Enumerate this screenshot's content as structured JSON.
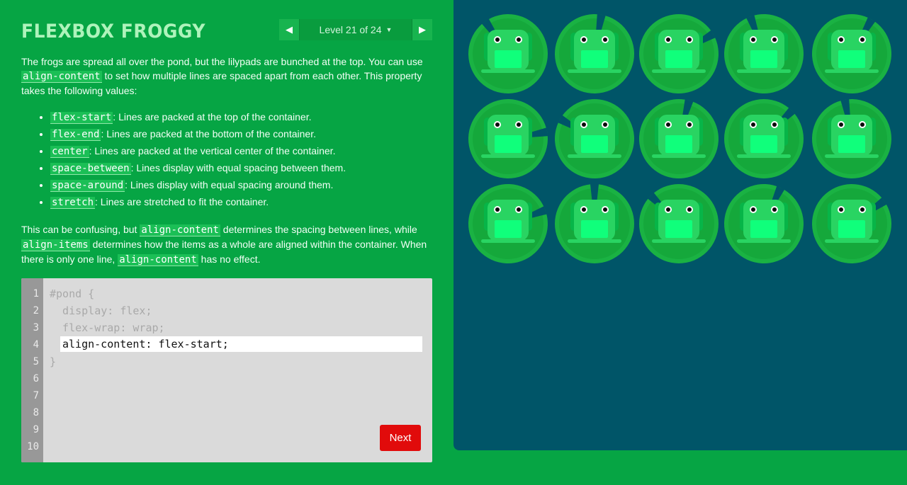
{
  "app": {
    "title": "FLEXBOX FROGGY"
  },
  "level_nav": {
    "label": "Level 21 of 24",
    "prev_icon": "arrow-left-icon",
    "next_icon": "arrow-right-icon",
    "dropdown_icon": "chevron-down-icon"
  },
  "instructions": {
    "intro_1": "The frogs are spread all over the pond, but the lilypads are bunched at the top. You can use ",
    "intro_code": "align-content",
    "intro_2": " to set how multiple lines are spaced apart from each other. This property takes the following values:",
    "values": [
      {
        "code": "flex-start",
        "text": ": Lines are packed at the top of the container."
      },
      {
        "code": "flex-end",
        "text": ": Lines are packed at the bottom of the container."
      },
      {
        "code": "center",
        "text": ": Lines are packed at the vertical center of the container."
      },
      {
        "code": "space-between",
        "text": ": Lines display with equal spacing between them."
      },
      {
        "code": "space-around",
        "text": ": Lines display with equal spacing around them."
      },
      {
        "code": "stretch",
        "text": ": Lines are stretched to fit the container."
      }
    ],
    "outro_1": "This can be confusing, but ",
    "outro_code_1": "align-content",
    "outro_2": " determines the spacing between lines, while ",
    "outro_code_2": "align-items",
    "outro_3": " determines how the items as a whole are aligned within the container. When there is only one line, ",
    "outro_code_3": "align-content",
    "outro_4": " has no effect."
  },
  "editor": {
    "line_numbers": [
      "1",
      "2",
      "3",
      "4",
      "5",
      "6",
      "7",
      "8",
      "9",
      "10"
    ],
    "code_lines": [
      "#pond {",
      "  display: flex;",
      "  flex-wrap: wrap;",
      "",
      "}"
    ],
    "input_value": "align-content: flex-start;",
    "next_label": "Next"
  },
  "pond": {
    "colors": {
      "water": "#005568",
      "lilypad": "#1ab243",
      "lilypad_dark": "#0e952f",
      "frog": "#29d462",
      "frog_dark": "#07b548",
      "frog_belly": "#10ff7b"
    },
    "rows": 3,
    "columns": 5,
    "lilypad_count": 15,
    "frog_count": 15
  }
}
